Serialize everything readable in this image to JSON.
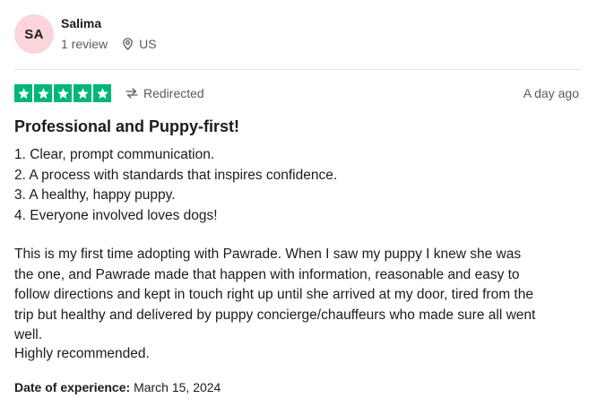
{
  "reviewer": {
    "initials": "SA",
    "name": "Salima",
    "review_count": "1 review",
    "country": "US",
    "avatar_color": "#fbd5da",
    "location_icon": "location-pin-icon"
  },
  "rating": {
    "stars": 5,
    "max_stars": 5,
    "star_color": "#00b67a",
    "verification_label": "Redirected",
    "verification_icon": "redirect-arrow-icon",
    "posted": "A day ago"
  },
  "review": {
    "title": "Professional and Puppy-first!",
    "points": [
      "1. Clear, prompt communication.",
      "2. A process with standards that inspires confidence.",
      "3. A healthy, happy puppy.",
      "4. Everyone involved loves dogs!"
    ],
    "body_lines": [
      "This is my first time adopting with Pawrade. When I saw my puppy I knew she was",
      "the one, and Pawrade made that happen with information, reasonable and easy to",
      "follow directions and kept in touch right up until she arrived at my door, tired from the",
      "trip but healthy and delivered by puppy concierge/chauffeurs who made sure all went",
      "well."
    ],
    "closing": "Highly recommended."
  },
  "experience": {
    "label": "Date of experience:",
    "date": "March 15, 2024"
  }
}
